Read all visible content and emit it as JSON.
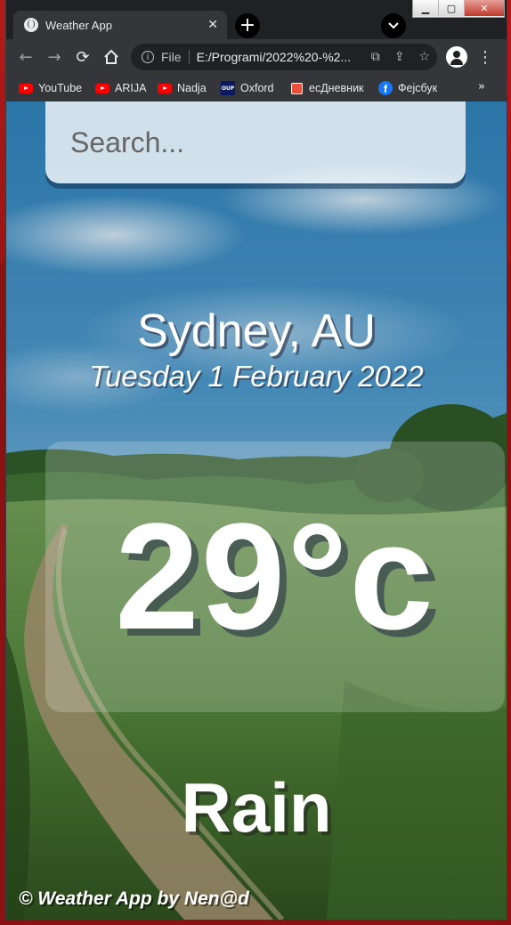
{
  "browser": {
    "tab_title": "Weather App",
    "tab_close": "✕",
    "new_tab": "+",
    "tab_search": "⌄",
    "address": {
      "scheme": "File",
      "url": "E:/Programi/2022%20-%2..."
    },
    "window_controls": {
      "minimize": "▁",
      "maximize": "▢",
      "close": "✕"
    },
    "bookmarks": [
      {
        "label": "YouTube",
        "icon": "youtube-icon"
      },
      {
        "label": "ARIJA",
        "icon": "youtube-icon"
      },
      {
        "label": "Nadja",
        "icon": "youtube-icon"
      },
      {
        "label": "Oxford",
        "icon": "oup-icon"
      },
      {
        "label": "есДневник",
        "icon": "esdnevnik-icon"
      },
      {
        "label": "Фејсбук",
        "icon": "facebook-icon"
      }
    ],
    "bookmarks_more": "»"
  },
  "app": {
    "search": {
      "placeholder": "Search...",
      "value": ""
    },
    "location": "Sydney, AU",
    "date": "Tuesday 1 February 2022",
    "temperature": "29°c",
    "condition": "Rain",
    "footer": "© Weather App by Nen@d"
  },
  "colors": {
    "browser_bg": "#202124",
    "toolbar_bg": "#35363a",
    "desktop_red": "#9b1515",
    "text_white": "#ffffff"
  }
}
